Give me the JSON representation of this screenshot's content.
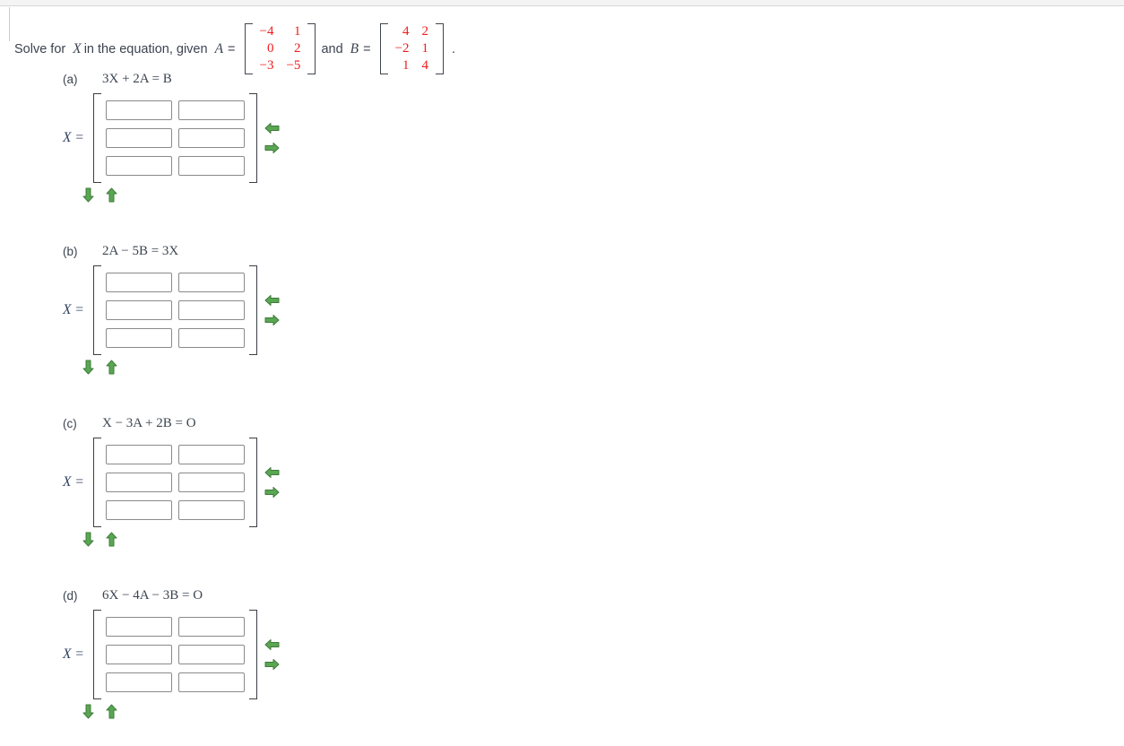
{
  "problem": {
    "prefix": "Solve for",
    "var": "X",
    "mid": "in the equation, given",
    "matrix_a_label": "A",
    "matrix_b_label": "B",
    "equals": "=",
    "conjunction": "and",
    "period": ".",
    "matrix_a": [
      [
        "-4",
        "1"
      ],
      [
        "0",
        "2"
      ],
      [
        "-3",
        "-5"
      ]
    ],
    "matrix_b": [
      [
        "4",
        "2"
      ],
      [
        "-2",
        "1"
      ],
      [
        "1",
        "4"
      ]
    ],
    "matrix_value_color": "#ee1c1c"
  },
  "answer_label": "X =",
  "cell_placeholder": "",
  "cell_value": "",
  "controls": {
    "remove_column_icon": "arrow-left-icon",
    "add_column_icon": "arrow-right-icon",
    "remove_row_icon": "arrow-down-icon",
    "add_row_icon": "arrow-up-icon",
    "arrow_color": "#5aa653"
  },
  "parts": [
    {
      "label": "(a)",
      "equation": "3X + 2A = B"
    },
    {
      "label": "(b)",
      "equation": "2A − 5B = 3X"
    },
    {
      "label": "(c)",
      "equation": "X − 3A + 2B = O"
    },
    {
      "label": "(d)",
      "equation": "6X − 4A − 3B = O"
    }
  ]
}
